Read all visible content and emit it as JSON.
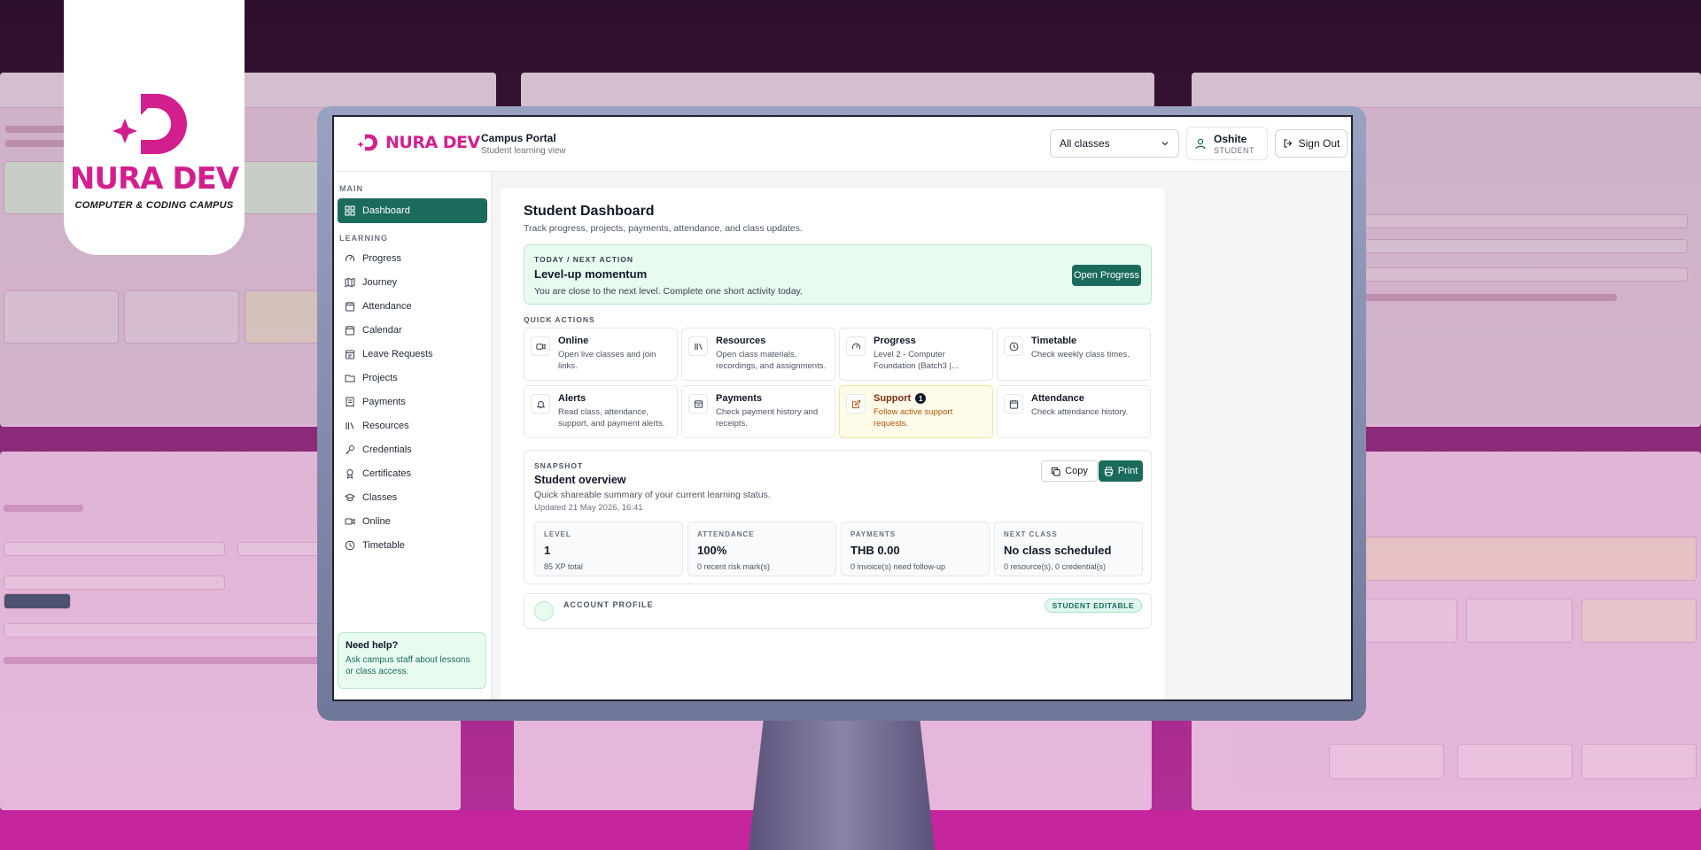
{
  "brand": {
    "name": "NURA DEV",
    "tagline": "COMPUTER & CODING CAMPUS",
    "color": "#d31f8e"
  },
  "header": {
    "portal_title": "Campus Portal",
    "portal_subtitle": "Student learning view",
    "class_select_value": "All classes",
    "user_name": "Oshite",
    "user_role": "STUDENT",
    "signout_label": "Sign Out"
  },
  "sidebar": {
    "section_main": "MAIN",
    "section_learning": "LEARNING",
    "dashboard": "Dashboard",
    "items": [
      {
        "label": "Progress",
        "icon": "gauge-icon"
      },
      {
        "label": "Journey",
        "icon": "map-icon"
      },
      {
        "label": "Attendance",
        "icon": "calendar-check-icon"
      },
      {
        "label": "Calendar",
        "icon": "calendar-icon"
      },
      {
        "label": "Leave Requests",
        "icon": "calendar-leave-icon"
      },
      {
        "label": "Projects",
        "icon": "folder-icon"
      },
      {
        "label": "Payments",
        "icon": "receipt-icon"
      },
      {
        "label": "Resources",
        "icon": "library-icon"
      },
      {
        "label": "Credentials",
        "icon": "key-icon"
      },
      {
        "label": "Certificates",
        "icon": "award-icon"
      },
      {
        "label": "Classes",
        "icon": "graduation-cap-icon"
      },
      {
        "label": "Online",
        "icon": "video-icon"
      },
      {
        "label": "Timetable",
        "icon": "clock-icon"
      }
    ],
    "help_title": "Need help?",
    "help_text": "Ask campus staff about lessons or class access."
  },
  "main": {
    "title": "Student Dashboard",
    "subtitle": "Track progress, projects, payments, attendance, and class updates.",
    "next_action": {
      "label": "TODAY / NEXT ACTION",
      "title": "Level-up momentum",
      "text": "You are close to the next level. Complete one short activity today.",
      "button": "Open Progress"
    },
    "quick_actions_label": "QUICK ACTIONS",
    "quick_actions": [
      {
        "title": "Online",
        "desc": "Open live classes and join links."
      },
      {
        "title": "Resources",
        "desc": "Open class materials, recordings, and assignments."
      },
      {
        "title": "Progress",
        "desc": "Level 2 - Computer Foundation (Batch3 |..."
      },
      {
        "title": "Timetable",
        "desc": "Check weekly class times."
      },
      {
        "title": "Alerts",
        "desc": "Read class, attendance, support, and payment alerts."
      },
      {
        "title": "Payments",
        "desc": "Check payment history and receipts."
      },
      {
        "title": "Support",
        "desc": "Follow active support requests.",
        "badge": "1"
      },
      {
        "title": "Attendance",
        "desc": "Check attendance history."
      }
    ],
    "snapshot": {
      "label": "SNAPSHOT",
      "title": "Student overview",
      "subtitle": "Quick shareable summary of your current learning status.",
      "updated": "Updated 21 May 2026, 16:41",
      "copy_label": "Copy",
      "print_label": "Print",
      "stats": [
        {
          "label": "LEVEL",
          "value": "1",
          "note": "85 XP total"
        },
        {
          "label": "ATTENDANCE",
          "value": "100%",
          "note": "0 recent risk mark(s)"
        },
        {
          "label": "PAYMENTS",
          "value": "THB 0.00",
          "note": "0 invoice(s) need follow-up"
        },
        {
          "label": "NEXT CLASS",
          "value": "No class scheduled",
          "note": "0 resource(s), 0 credential(s)"
        }
      ]
    },
    "account": {
      "label": "ACCOUNT PROFILE",
      "badge": "STUDENT EDITABLE"
    }
  },
  "colors": {
    "primary": "#1b6b5d",
    "success_bg": "#e8fbef",
    "warn_bg": "#fefbe9"
  }
}
